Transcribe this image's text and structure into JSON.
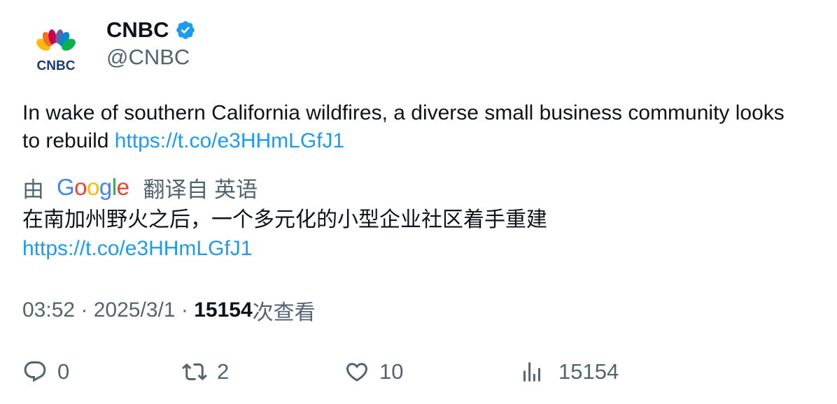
{
  "author": {
    "display_name": "CNBC",
    "handle": "@CNBC",
    "verified": true,
    "avatar_icon": "cnbc-peacock-logo",
    "logo_text": "CNBC"
  },
  "tweet": {
    "text": "In wake of southern California wildfires, a diverse small business community looks to rebuild ",
    "link": "https://t.co/e3HHmLGfJ1"
  },
  "translation": {
    "prefix": "由",
    "provider": "Google",
    "suffix": "翻译自 英语",
    "text": "在南加州野火之后，一个多元化的小型企业社区着手重建",
    "link": "https://t.co/e3HHmLGfJ1"
  },
  "meta": {
    "time": "03:52",
    "separator": " · ",
    "date": "2025/3/1",
    "views_count": "15154",
    "views_label": "次查看"
  },
  "actions": {
    "replies": "0",
    "retweets": "2",
    "likes": "10",
    "views": "15154"
  },
  "colors": {
    "link": "#1d9bf0",
    "secondary_text": "#536471",
    "primary_text": "#0f1419",
    "verified_badge": "#1d9bf0"
  }
}
